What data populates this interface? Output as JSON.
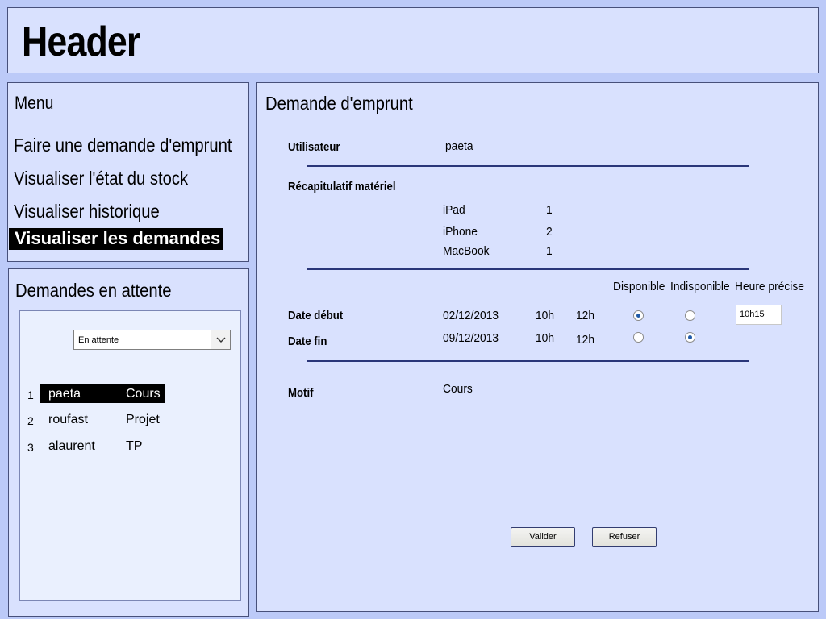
{
  "header": {
    "title": "Header"
  },
  "menu": {
    "title": "Menu",
    "items": [
      {
        "label": "Faire une demande d'emprunt"
      },
      {
        "label": "Visualiser l'état du stock"
      },
      {
        "label": "Visualiser historique"
      },
      {
        "label": "Visualiser les demandes",
        "active": true
      }
    ]
  },
  "pending": {
    "title": "Demandes en attente",
    "filter": {
      "selected": "En attente"
    },
    "rows": [
      {
        "num": "1",
        "name": "paeta",
        "reason": "Cours",
        "selected": true
      },
      {
        "num": "2",
        "name": "roufast",
        "reason": "Projet"
      },
      {
        "num": "3",
        "name": "alaurent",
        "reason": "TP"
      }
    ]
  },
  "request": {
    "title": "Demande d'emprunt",
    "user_label": "Utilisateur",
    "user_value": "paeta",
    "equipment_label": "Récapitulatif matériel",
    "equipment": [
      {
        "name": "iPad",
        "qty": "1"
      },
      {
        "name": "iPhone",
        "qty": "2"
      },
      {
        "name": "MacBook",
        "qty": "1"
      }
    ],
    "col_available": "Disponible",
    "col_unavailable": "Indisponible",
    "col_exact_time": "Heure précise",
    "start": {
      "label": "Date début",
      "date": "02/12/2013",
      "from": "10h",
      "to": "12h",
      "available": true,
      "exact_time": "10h15"
    },
    "end": {
      "label": "Date fin",
      "date": "09/12/2013",
      "from": "10h",
      "to": "12h",
      "available": false
    },
    "reason_label": "Motif",
    "reason_value": "Cours",
    "validate_label": "Valider",
    "refuse_label": "Refuser"
  }
}
